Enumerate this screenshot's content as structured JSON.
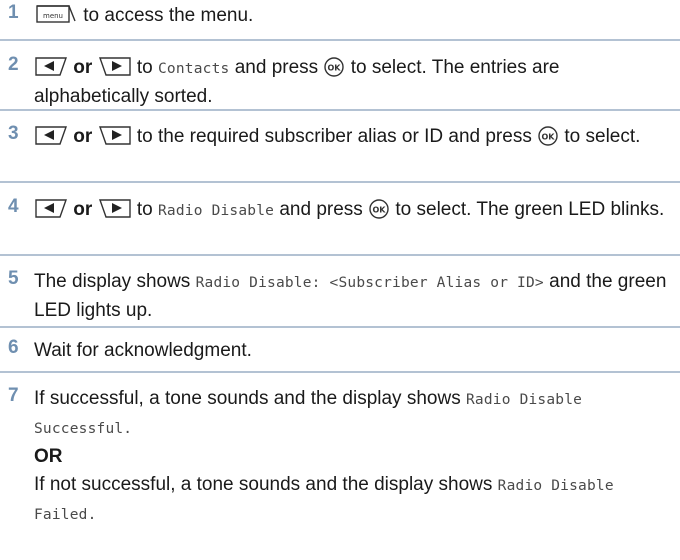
{
  "steps": [
    {
      "num": "1",
      "text_a": "to access the menu."
    },
    {
      "num": "2",
      "or": "or",
      "text_a": "to",
      "mono_a": "Contacts",
      "text_b": "and press",
      "text_c": "to select. The entries are alphabetically sorted."
    },
    {
      "num": "3",
      "or": "or",
      "text_a": "to the required subscriber alias or ID and press",
      "text_b": "to select."
    },
    {
      "num": "4",
      "or": "or",
      "text_a": "to",
      "mono_a": "Radio Disable",
      "text_b": "and press",
      "text_c": "to select. The green LED blinks."
    },
    {
      "num": "5",
      "text_a": "The display shows",
      "mono_a": "Radio Disable: <Subscriber Alias or ID>",
      "text_b": "and the green LED lights up."
    },
    {
      "num": "6",
      "text_a": "Wait for acknowledgment."
    },
    {
      "num": "7",
      "text_a": "If successful, a tone sounds and the display shows",
      "mono_a": "Radio Disable Successful.",
      "or_label": "OR",
      "text_b": "If not successful, a tone sounds and the display shows",
      "mono_b": "Radio Disable Failed."
    }
  ],
  "icons": {
    "menu_key_label": "menu"
  },
  "colors": {
    "step_number": "#6f8fb0",
    "divider": "#b3c2d3"
  }
}
